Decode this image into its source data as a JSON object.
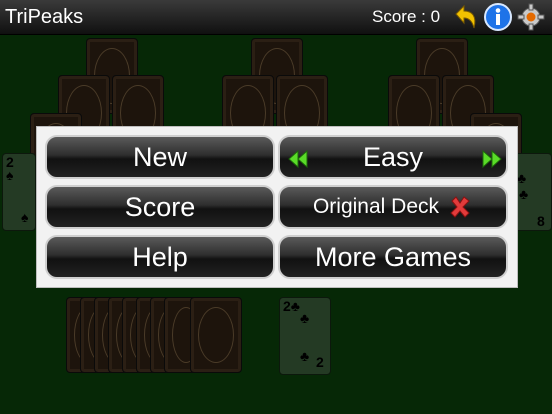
{
  "app": {
    "title": "TriPeaks"
  },
  "score": {
    "label": "Score :",
    "value": "0"
  },
  "icons": {
    "undo": "undo-arrow-icon",
    "info": "info-icon",
    "settings": "gear-icon"
  },
  "colors": {
    "felt": "#072807",
    "info_blue": "#1e73e8",
    "undo_yellow": "#f2c200",
    "arrow_green": "#5adc28",
    "close_red": "#e23b3b"
  },
  "menu": {
    "new_label": "New",
    "score_label": "Score",
    "help_label": "Help",
    "difficulty": {
      "value": "Easy"
    },
    "deck_label": "Original Deck",
    "more_games_label": "More Games"
  },
  "cards": {
    "left_partial": {
      "rank": "2"
    },
    "right_partial": {
      "rank": "8"
    },
    "waste": {
      "rank": "2"
    }
  }
}
